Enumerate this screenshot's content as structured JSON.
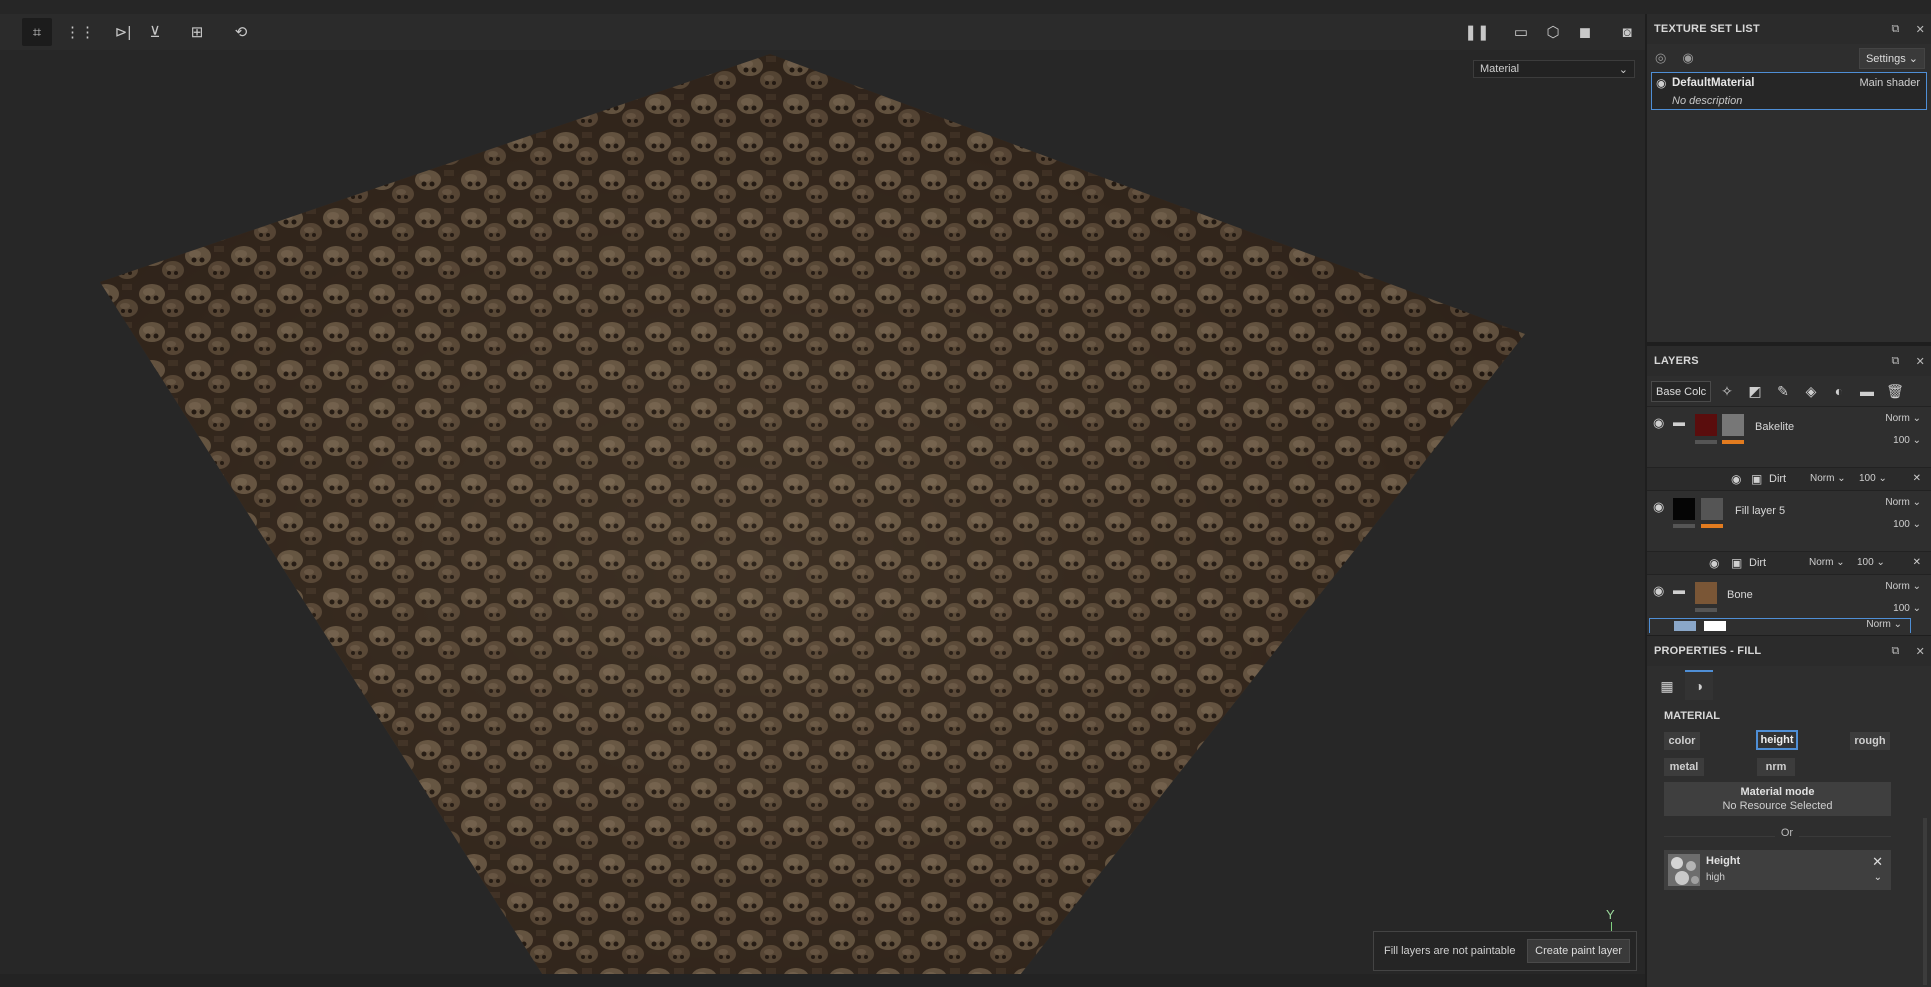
{
  "toolbar": {
    "buttons": [
      "selection-icon",
      "grid-icon",
      "mirror-x-icon",
      "mirror-y-icon",
      "add-icon",
      "history-icon"
    ],
    "right_buttons": [
      "pause-icon",
      "camera-2d-icon",
      "cube-icon",
      "video-camera-icon",
      "screenshot-icon"
    ]
  },
  "viewport": {
    "display_mode": "Material",
    "axis_label": "Y",
    "notification": {
      "text": "Fill layers are not paintable",
      "button": "Create paint layer"
    }
  },
  "texture_set_list": {
    "title": "TEXTURE SET LIST",
    "settings_label": "Settings",
    "item": {
      "name": "DefaultMaterial",
      "shader": "Main shader",
      "description": "No description"
    }
  },
  "layers": {
    "title": "LAYERS",
    "channel": "Base Colc",
    "items": [
      {
        "name": "Bakelite",
        "blend": "Norm",
        "opacity": "100",
        "color": "#5a0d0d"
      },
      {
        "name": "Dirt",
        "blend": "Norm",
        "opacity": "100",
        "sub": true
      },
      {
        "name": "Fill layer 5",
        "blend": "Norm",
        "opacity": "100",
        "color": "#050505"
      },
      {
        "name": "Dirt",
        "blend": "Norm",
        "opacity": "100",
        "sub": true
      },
      {
        "name": "Bone",
        "blend": "Norm",
        "opacity": "100",
        "color": "#7a5636"
      },
      {
        "name": "",
        "blend": "Norm"
      }
    ]
  },
  "properties": {
    "title": "PROPERTIES - FILL",
    "section": "MATERIAL",
    "chips": [
      "color",
      "height",
      "rough",
      "metal",
      "nrm"
    ],
    "active_chip": "height",
    "material_mode": {
      "title": "Material mode",
      "value": "No Resource Selected"
    },
    "or_label": "Or",
    "resource": {
      "name": "Height",
      "value": "high"
    }
  },
  "colors": {
    "accent": "#4f8fd6",
    "orange": "#e27b1f"
  }
}
